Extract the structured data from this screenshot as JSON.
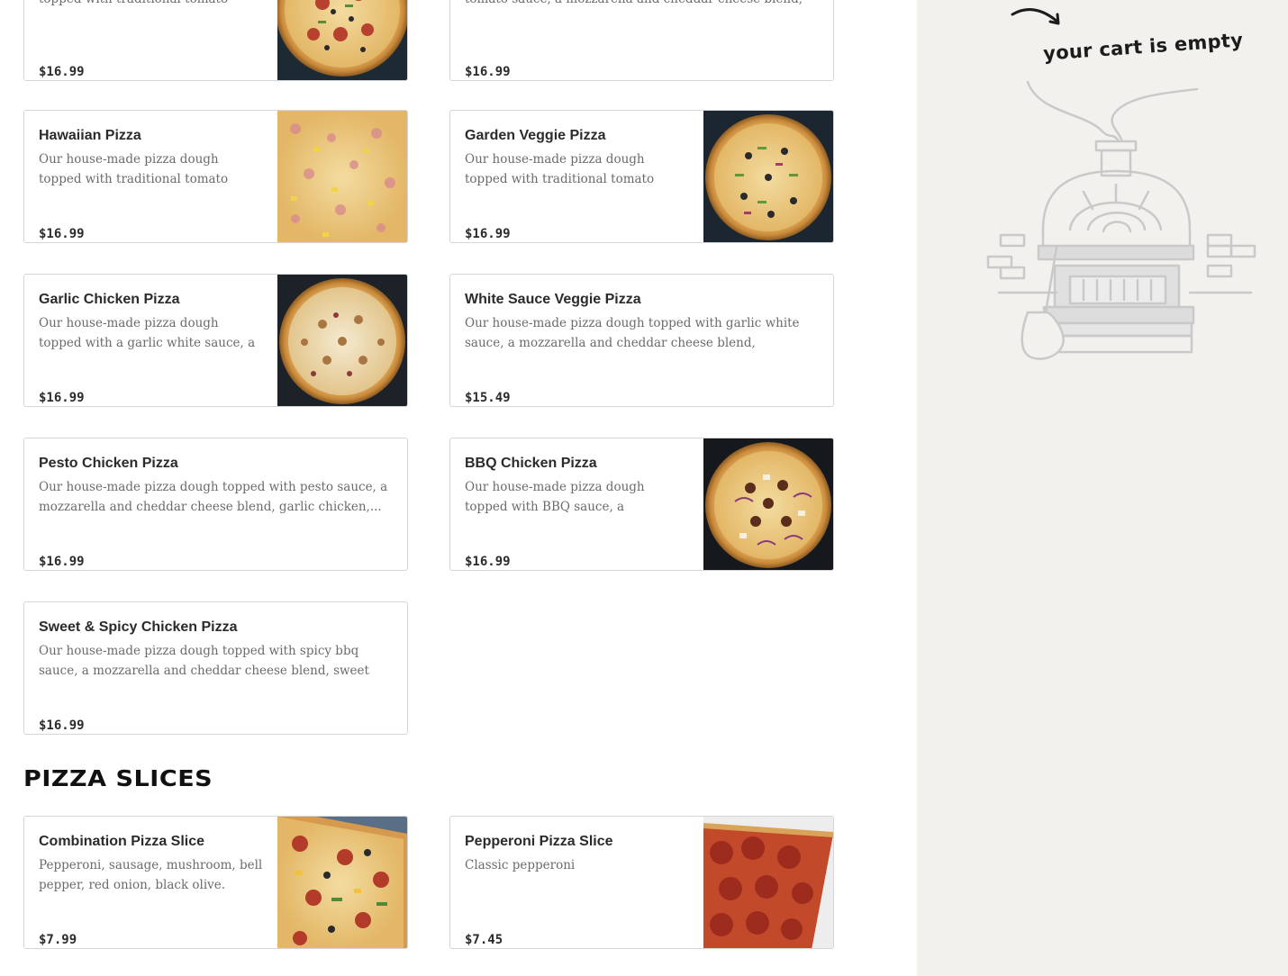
{
  "menu": {
    "section_slices_title": "PIZZA SLICES",
    "top_cards": [
      {
        "desc": "Our house-made pizza dough topped with traditional tomato sauce, a...",
        "price": "$16.99"
      },
      {
        "desc": "Our house-made pizza dough topped with traditional tomato sauce, a mozzarella and cheddar cheese blend, pepperoni,...",
        "price": "$16.99"
      }
    ],
    "items": [
      {
        "name": "Hawaiian Pizza",
        "desc": "Our house-made pizza dough topped with traditional tomato sauce, a...",
        "price": "$16.99"
      },
      {
        "name": "Garden Veggie Pizza",
        "desc": "Our house-made pizza dough topped with traditional tomato sauce, a...",
        "price": "$16.99"
      },
      {
        "name": "Garlic Chicken Pizza",
        "desc": "Our house-made pizza dough topped with a garlic white sauce, a mozzarell...",
        "price": "$16.99"
      },
      {
        "name": "White Sauce Veggie Pizza",
        "desc": "Our house-made pizza dough topped with garlic white sauce, a mozzarella and cheddar cheese blend, mushroom, red onion,...",
        "price": "$15.49"
      },
      {
        "name": "Pesto Chicken Pizza",
        "desc": "Our house-made pizza dough topped with pesto sauce, a mozzarella and cheddar cheese blend, garlic chicken,...",
        "price": "$16.99"
      },
      {
        "name": "BBQ Chicken Pizza",
        "desc": "Our house-made pizza dough topped with BBQ sauce, a mozzarella and...",
        "price": "$16.99"
      },
      {
        "name": "Sweet & Spicy Chicken Pizza",
        "desc": "Our house-made pizza dough topped with spicy bbq sauce, a mozzarella and cheddar cheese blend, sweet chili chicken,...",
        "price": "$16.99"
      }
    ],
    "slices": [
      {
        "name": "Combination Pizza Slice",
        "desc": "Pepperoni, sausage, mushroom, bell pepper, red onion, black olive.",
        "price": "$7.99"
      },
      {
        "name": "Pepperoni Pizza Slice",
        "desc": "Classic pepperoni",
        "price": "$7.45"
      }
    ]
  },
  "cart": {
    "empty_text": "your cart is empty",
    "arrow_icon": "curved-arrow-icon",
    "illustration": "pizza-oven-illustration"
  },
  "colors": {
    "sidebar_bg": "#f2f1ee",
    "card_border": "#d6d6d6",
    "text_dark": "#2b2b2b",
    "text_muted": "#6b6b6b"
  }
}
